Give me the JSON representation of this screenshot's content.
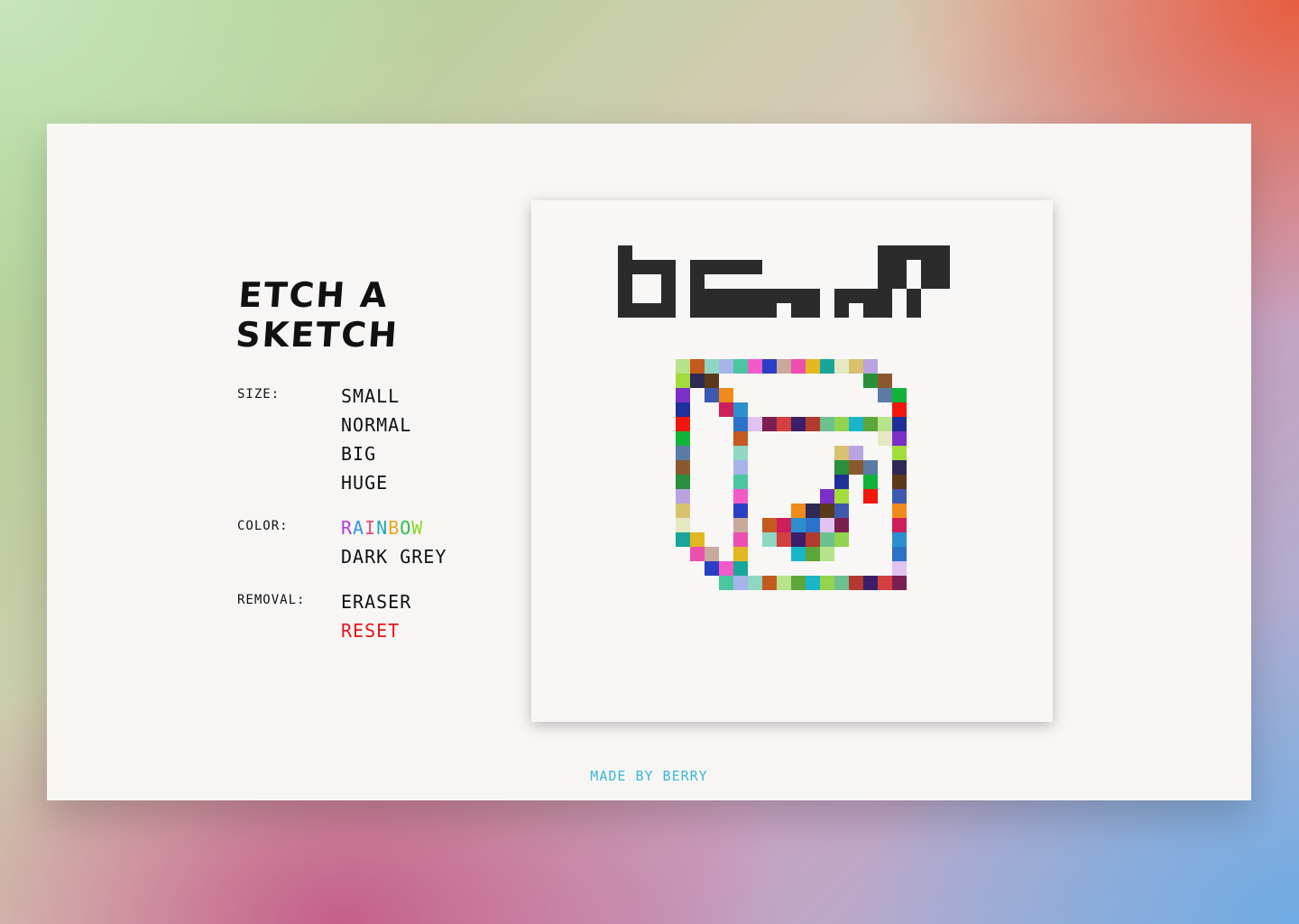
{
  "app": {
    "title": "ETCH A SKETCH",
    "footer": "MADE BY BERRY"
  },
  "options": {
    "size": {
      "label": "SIZE:",
      "items": [
        "SMALL",
        "NORMAL",
        "BIG",
        "HUGE"
      ]
    },
    "color": {
      "label": "COLOR:",
      "items": [
        "RAINBOW",
        "DARK GREY"
      ],
      "rainbow_letter_colors": [
        "#b03ae8",
        "#3b8ef0",
        "#e84b7a",
        "#1fa7b8",
        "#f0a51f",
        "#27c24c",
        "#8ad72a"
      ]
    },
    "removal": {
      "label": "REMOVAL:",
      "items": [
        "ERASER",
        "RESET"
      ]
    }
  },
  "colors": {
    "ink": "#2b2b2b",
    "reset": "#e5141b",
    "footer": "#3ab7d8",
    "canvas_bg": "#f8f7f5"
  }
}
